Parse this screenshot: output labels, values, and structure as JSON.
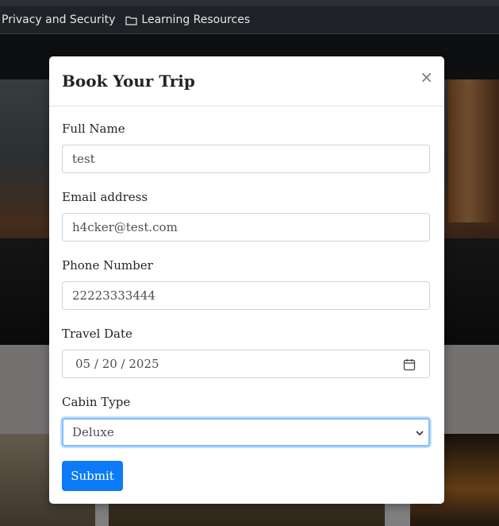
{
  "bookmarks": {
    "items": [
      {
        "label": "Privacy and Security"
      },
      {
        "label": "Learning Resources",
        "icon": "folder-icon"
      }
    ]
  },
  "modal": {
    "title": "Book Your Trip",
    "close_label": "×",
    "fields": {
      "full_name": {
        "label": "Full Name",
        "value": "test"
      },
      "email": {
        "label": "Email address",
        "value": "h4cker@test.com"
      },
      "phone": {
        "label": "Phone Number",
        "value": "22223333444"
      },
      "travel_date": {
        "label": "Travel Date",
        "month": "05",
        "day": "20",
        "year": "2025",
        "sep": " / "
      },
      "cabin_type": {
        "label": "Cabin Type",
        "value": "Deluxe"
      }
    },
    "submit_label": "Submit"
  },
  "colors": {
    "primary": "#0d7bf7",
    "focus_border": "#80bdff",
    "overlay": "rgba(0,0,0,0.5)"
  }
}
